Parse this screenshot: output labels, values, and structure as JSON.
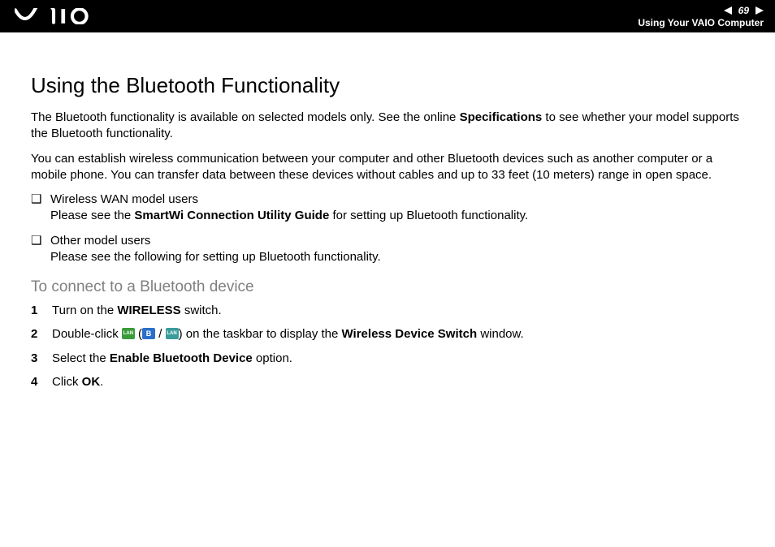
{
  "header": {
    "page_number": "69",
    "section": "Using Your VAIO Computer"
  },
  "title": "Using the Bluetooth Functionality",
  "para1_a": "The Bluetooth functionality is available on selected models only. See the online ",
  "para1_bold": "Specifications",
  "para1_b": " to see whether your model supports the Bluetooth functionality.",
  "para2": "You can establish wireless communication between your computer and other Bluetooth devices such as another computer or a mobile phone. You can transfer data between these devices without cables and up to 33 feet (10 meters) range in open space.",
  "bullets": [
    {
      "head": "Wireless WAN model users",
      "body_a": "Please see the ",
      "body_bold": "SmartWi Connection Utility Guide",
      "body_b": " for setting up Bluetooth functionality."
    },
    {
      "head": "Other model users",
      "body_a": "Please see the following for setting up Bluetooth functionality.",
      "body_bold": "",
      "body_b": ""
    }
  ],
  "subhead": "To connect to a Bluetooth device",
  "steps": {
    "s1_a": "Turn on the ",
    "s1_bold": "WIRELESS",
    "s1_b": " switch.",
    "s2_a": "Double-click ",
    "s2_paren_open": " (",
    "s2_slash": " / ",
    "s2_paren_close": ") ",
    "s2_b": "on the taskbar to display the ",
    "s2_bold": "Wireless Device Switch",
    "s2_c": " window.",
    "s3_a": "Select the ",
    "s3_bold": "Enable Bluetooth Device",
    "s3_b": " option.",
    "s4_a": "Click ",
    "s4_bold": "OK",
    "s4_b": "."
  },
  "icons": {
    "b_letter": "B",
    "lan_label": "LAN"
  }
}
